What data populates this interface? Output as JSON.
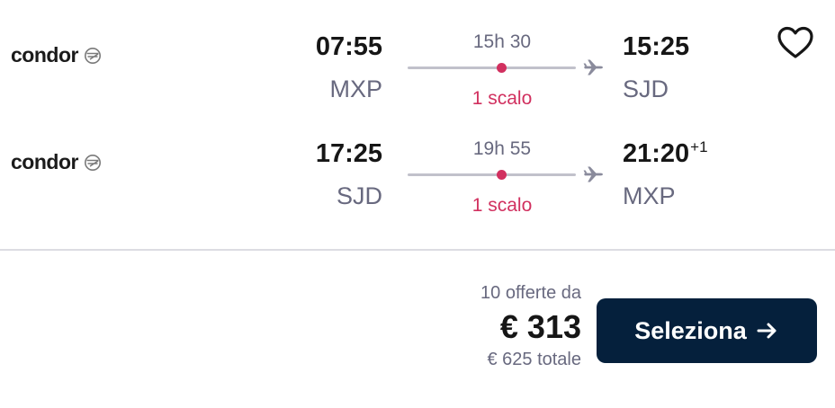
{
  "colors": {
    "accent_stop": "#d1305f",
    "button_bg": "#05203c",
    "muted_text": "#68697f",
    "line": "#c1c1cb"
  },
  "legs": [
    {
      "airline": "condor",
      "departure_time": "07:55",
      "departure_airport": "MXP",
      "duration": "15h 30",
      "stops": "1 scalo",
      "arrival_time": "15:25",
      "arrival_day_offset": "",
      "arrival_airport": "SJD"
    },
    {
      "airline": "condor",
      "departure_time": "17:25",
      "departure_airport": "SJD",
      "duration": "19h 55",
      "stops": "1 scalo",
      "arrival_time": "21:20",
      "arrival_day_offset": "+1",
      "arrival_airport": "MXP"
    }
  ],
  "icons": {
    "airline_logo": "condor-logo-icon",
    "plane": "plane-icon",
    "favorite": "heart-icon",
    "select_arrow": "arrow-right-icon"
  },
  "pricing": {
    "offers": "10 offerte da",
    "price": "€ 313",
    "total": "€ 625 totale"
  },
  "actions": {
    "select_label": "Seleziona"
  }
}
